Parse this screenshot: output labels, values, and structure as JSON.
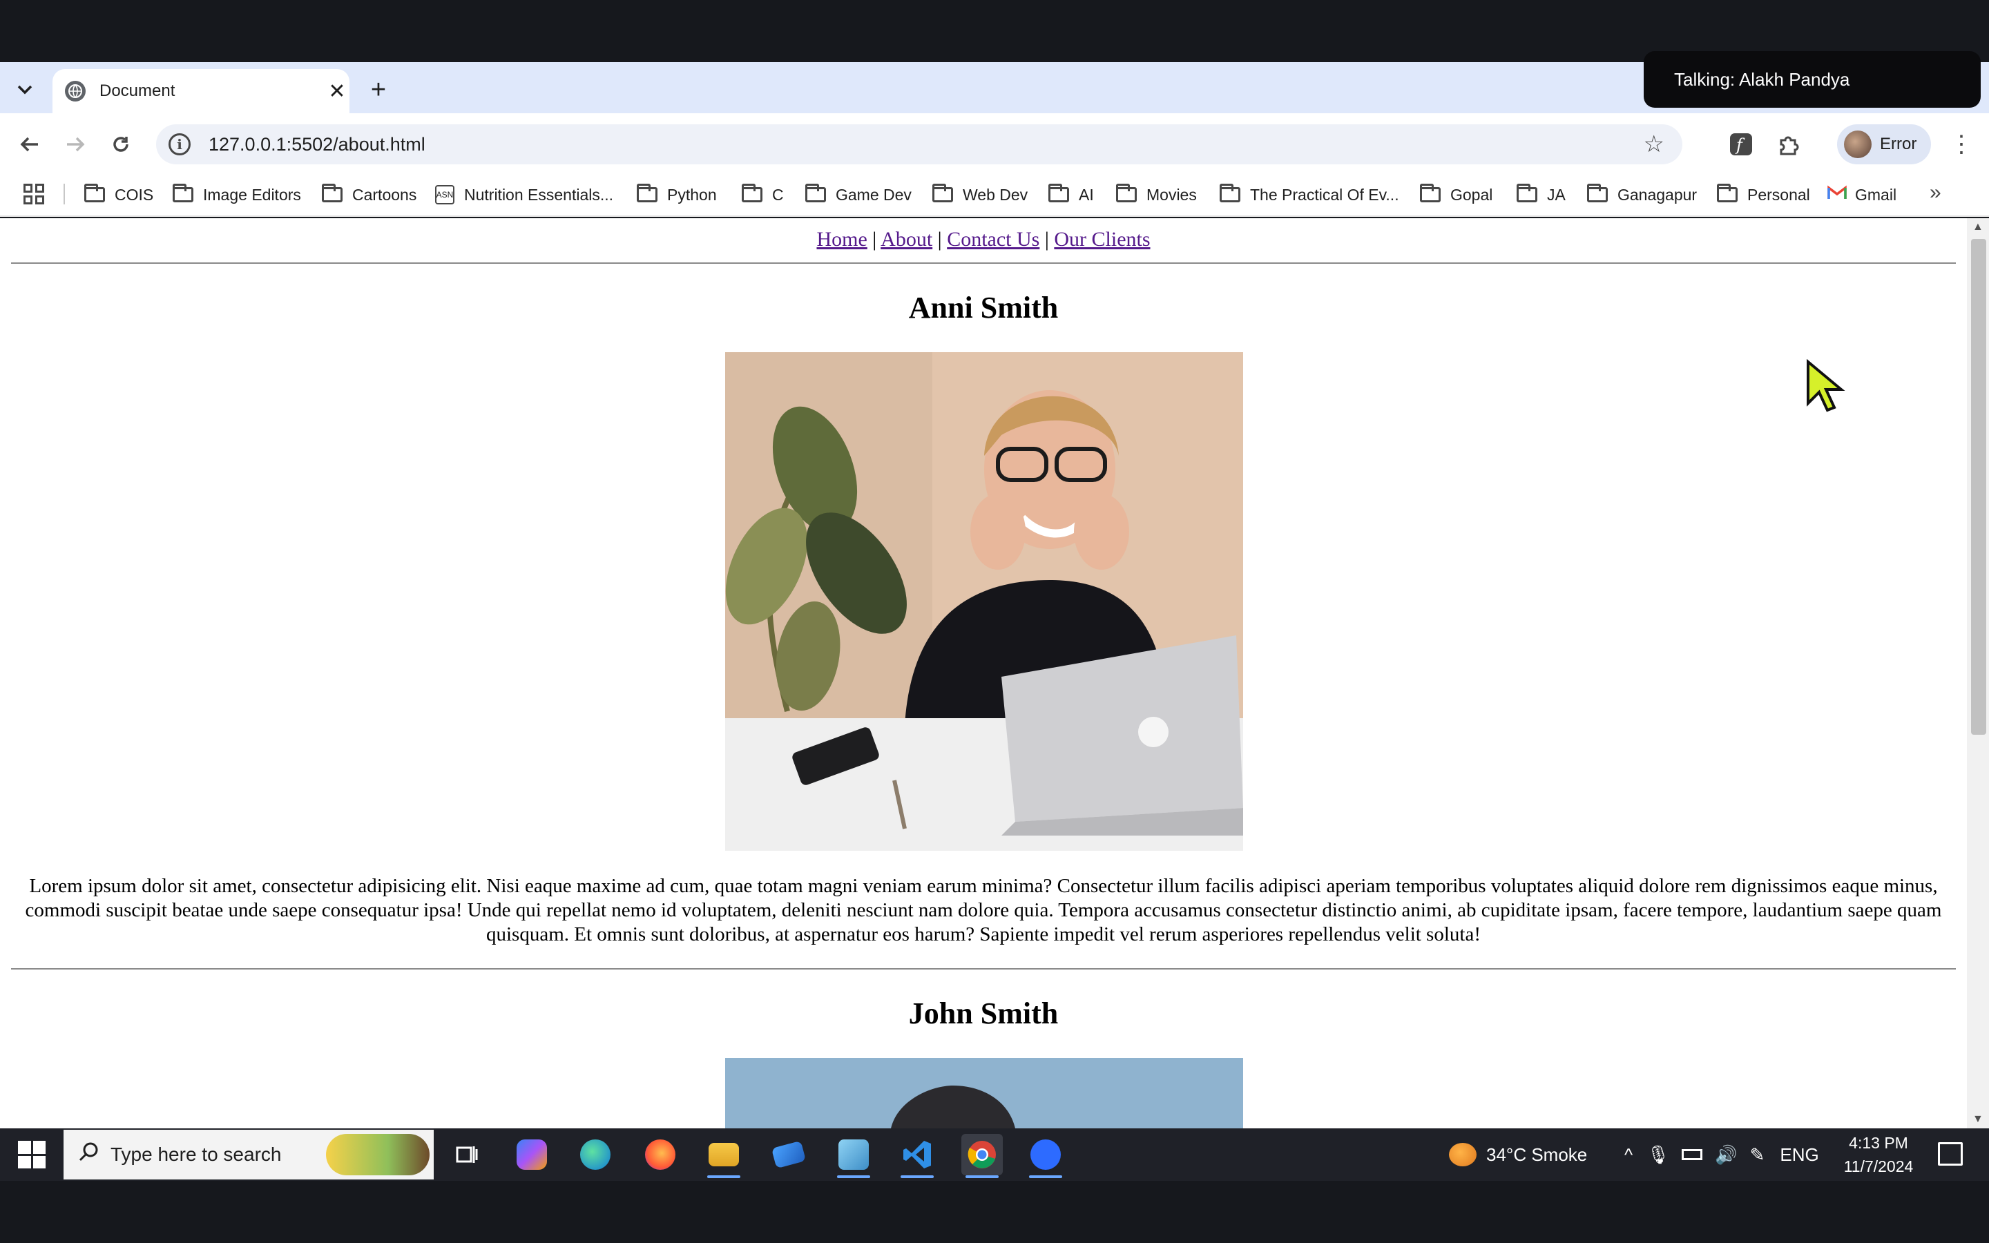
{
  "browser": {
    "tab": {
      "title": "Document"
    },
    "url": "127.0.0.1:5502/about.html",
    "profile_label": "Error",
    "bookmarks": [
      "COIS",
      "Image Editors",
      "Cartoons",
      "Nutrition Essentials...",
      "Python",
      "C",
      "Game Dev",
      "Web Dev",
      "AI",
      "Movies",
      "The Practical Of Ev...",
      "Gopal",
      "JA",
      "Ganagapur",
      "Personal",
      "Gmail"
    ]
  },
  "toast": {
    "text": "Talking: Alakh Pandya"
  },
  "page": {
    "nav": {
      "home": "Home",
      "about": "About",
      "contact": "Contact Us",
      "clients": "Our Clients",
      "sep": "|"
    },
    "people": [
      {
        "name": "Anni Smith",
        "bio": "Lorem ipsum dolor sit amet, consectetur adipisicing elit. Nisi eaque maxime ad cum, quae totam magni veniam earum minima? Consectetur illum facilis adipisci aperiam temporibus voluptates aliquid dolore rem dignissimos eaque minus, commodi suscipit beatae unde saepe consequatur ipsa! Unde qui repellat nemo id voluptatem, deleniti nesciunt nam dolore quia. Tempora accusamus consectetur distinctio animi, ab cupiditate ipsam, facere tempore, laudantium saepe quam quisquam. Et omnis sunt doloribus, at aspernatur eos harum? Sapiente impedit vel rerum asperiores repellendus velit soluta!"
      },
      {
        "name": "John Smith"
      }
    ]
  },
  "taskbar": {
    "search_placeholder": "Type here to search",
    "weather": "34°C  Smoke",
    "language": "ENG",
    "time": "4:13 PM",
    "date": "11/7/2024"
  },
  "colors": {
    "link": "#551a8b",
    "tabbar": "#dfe8fb",
    "taskbar": "#1f2128"
  }
}
